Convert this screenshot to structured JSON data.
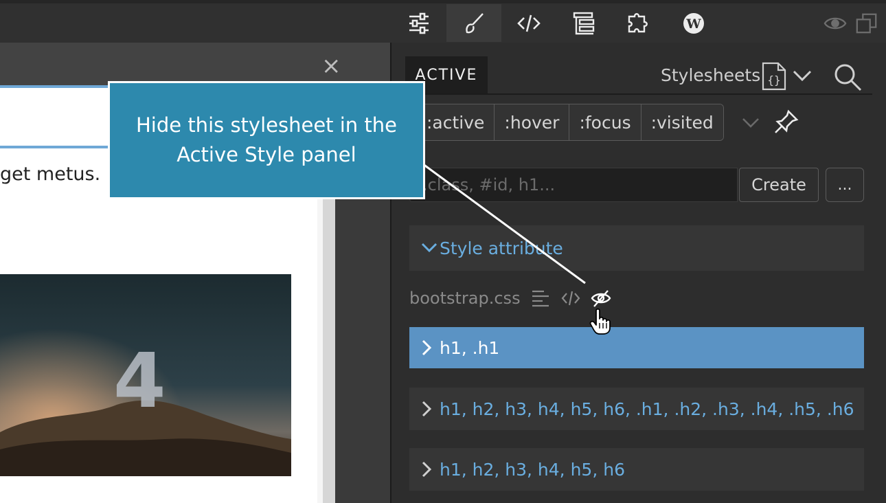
{
  "toolbar": {
    "tools": [
      {
        "name": "settings-sliders-icon",
        "active": false
      },
      {
        "name": "brush-icon",
        "active": true
      },
      {
        "name": "code-icon",
        "active": false
      },
      {
        "name": "tree-icon",
        "active": false
      },
      {
        "name": "puzzle-icon",
        "active": false
      },
      {
        "name": "wordpress-icon",
        "active": false
      }
    ],
    "right_icons": [
      "eye-icon",
      "windows-icon"
    ]
  },
  "preview": {
    "close_glyph": "×",
    "body_text": "get metus.",
    "hero_number": "4"
  },
  "tooltip": {
    "text": "Hide this stylesheet in the Active Style panel"
  },
  "panel": {
    "active_tab": "ACTIVE",
    "stylesheets_label": "Stylesheets",
    "pseudo_classes": [
      ":active",
      ":hover",
      ":focus",
      ":visited"
    ],
    "selector_placeholder": ".class, #id, h1...",
    "create_label": "Create",
    "more_label": "...",
    "style_attribute_label": "Style attribute",
    "stylesheet_name": "bootstrap.css",
    "rules": [
      {
        "selector": "h1, .h1",
        "selected": true
      },
      {
        "selector": "h1, h2, h3, h4, h5, h6, .h1, .h2, .h3, .h4, .h5, .h6",
        "selected": false
      },
      {
        "selector": "h1, h2, h3, h4, h5, h6",
        "selected": false
      }
    ]
  },
  "colors": {
    "accent_blue": "#5b93c4",
    "link_blue": "#6aaee0",
    "tooltip_bg": "#2d89ad"
  }
}
